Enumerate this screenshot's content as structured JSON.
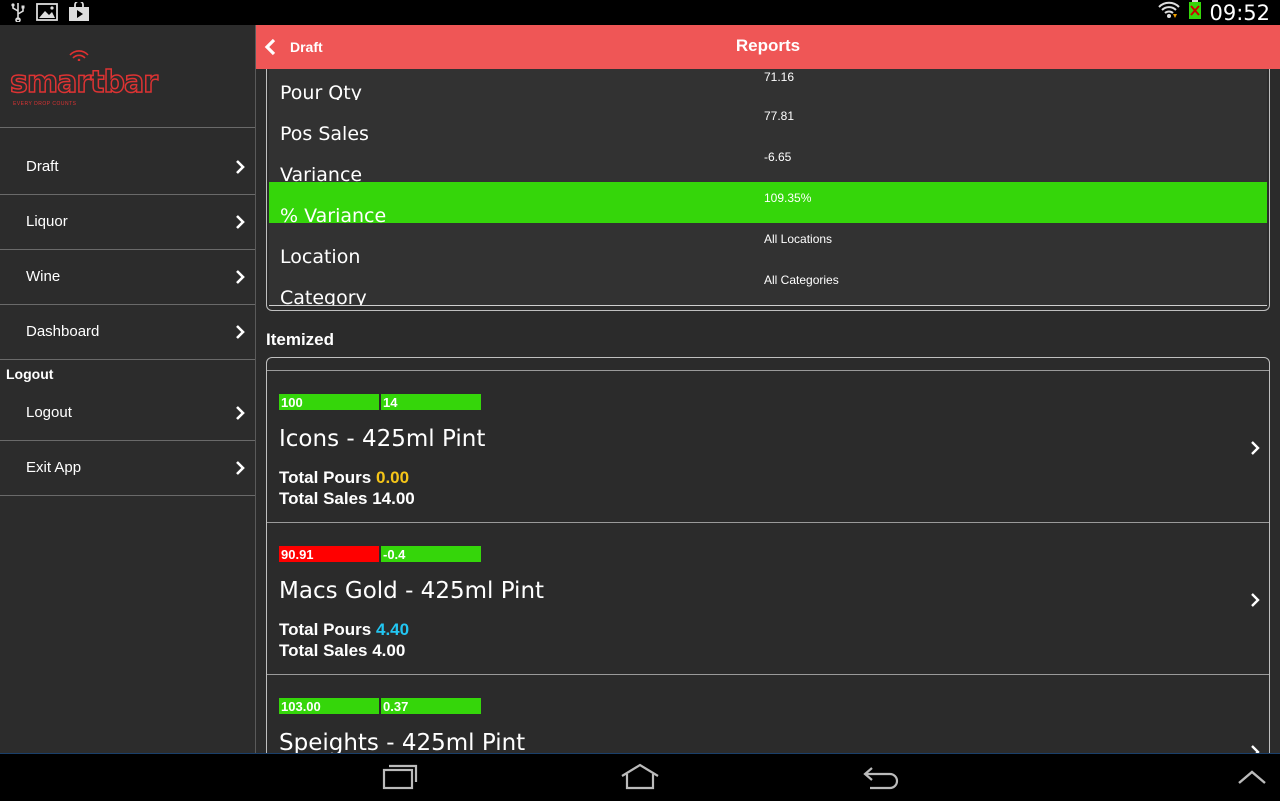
{
  "status_bar": {
    "time": "09:52"
  },
  "logo": {
    "text": "smartbar",
    "tagline": "EVERY DROP COUNTS"
  },
  "sidebar": {
    "items": [
      {
        "label": "Draft"
      },
      {
        "label": "Liquor"
      },
      {
        "label": "Wine"
      },
      {
        "label": "Dashboard"
      }
    ],
    "section_title": "Logout",
    "section_items": [
      {
        "label": "Logout"
      },
      {
        "label": "Exit App"
      }
    ]
  },
  "header": {
    "back_label": "Draft",
    "title": "Reports",
    "color": "#ef5656"
  },
  "summary": {
    "rows": [
      {
        "label": "Pour Qty",
        "value": "71.16"
      },
      {
        "label": "Pos Sales",
        "value": "77.81"
      },
      {
        "label": "Variance",
        "value": "-6.65"
      },
      {
        "label": "% Variance",
        "value": "109.35%"
      },
      {
        "label": "Location",
        "value": "All Locations"
      },
      {
        "label": "Category",
        "value": "All Categories"
      }
    ],
    "highlight_color": "#35d60a"
  },
  "itemized": {
    "title": "Itemized",
    "items": [
      {
        "badge1": "100",
        "badge1_color": "#35d60a",
        "badge2": "14",
        "badge2_color": "#35d60a",
        "name": "Icons - 425ml Pint",
        "pours_label": "Total Pours",
        "pours_value": "0.00",
        "pours_color": "#f5c518",
        "sales_text": "Total Sales 14.00"
      },
      {
        "badge1": "90.91",
        "badge1_color": "#ff0000",
        "badge2": "-0.4",
        "badge2_color": "#35d60a",
        "name": "Macs Gold - 425ml Pint",
        "pours_label": "Total Pours",
        "pours_value": "4.40",
        "pours_color": "#22c6f2",
        "sales_text": "Total Sales 4.00"
      },
      {
        "badge1": "103.00",
        "badge1_color": "#35d60a",
        "badge2": "0.37",
        "badge2_color": "#35d60a",
        "name": "Speights - 425ml Pint",
        "pours_label": "Total Pours",
        "pours_value": "",
        "pours_color": "#22c6f2",
        "sales_text": ""
      }
    ]
  }
}
